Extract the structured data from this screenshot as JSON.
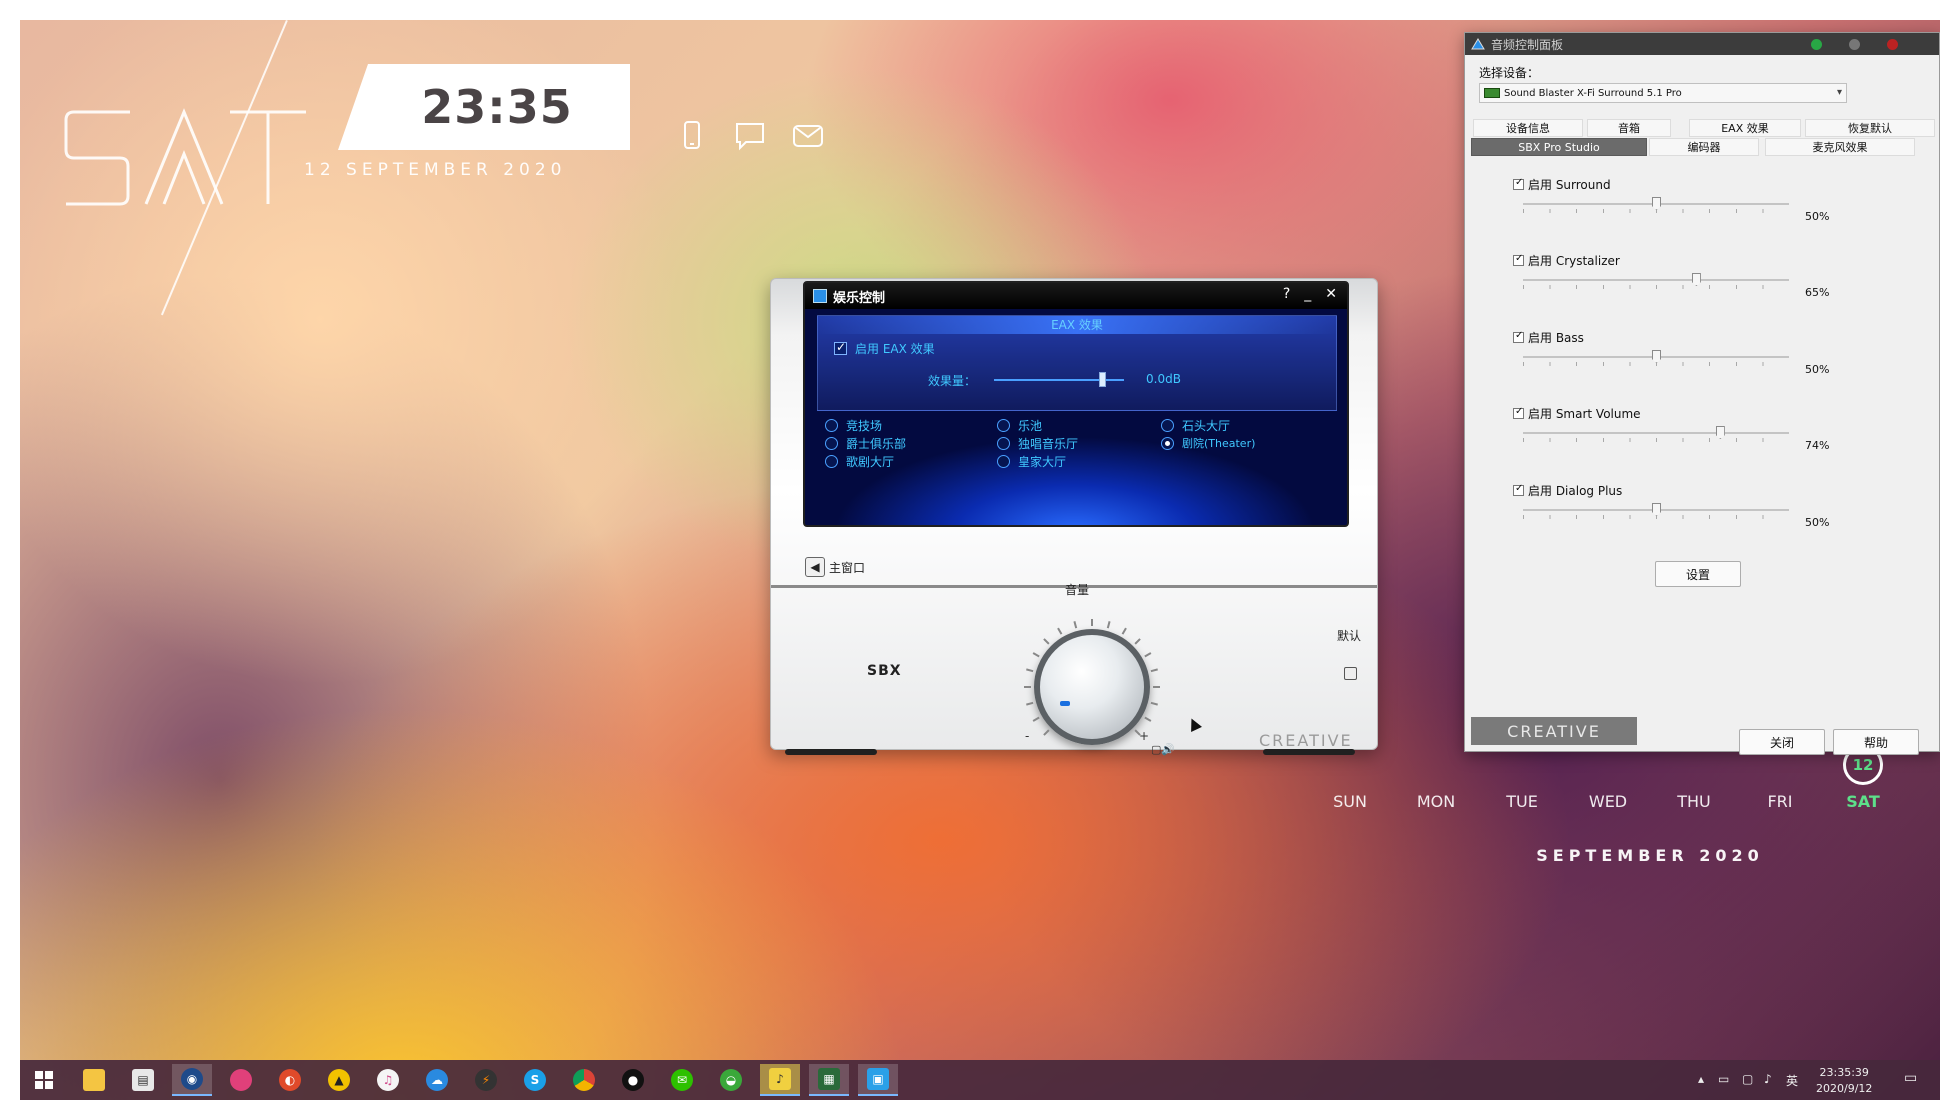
{
  "desktop": {
    "day": "SAT",
    "clock": "23:35",
    "date": "12 SEPTEMBER 2020",
    "widget_icons": [
      "phone-icon",
      "chat-icon",
      "mail-icon"
    ],
    "calendar": {
      "days": [
        "SUN",
        "MON",
        "TUE",
        "WED",
        "THU",
        "FRI",
        "SAT"
      ],
      "active_day": "SAT",
      "today_number": "12",
      "month": "SEPTEMBER 2020"
    }
  },
  "entertainment": {
    "title": "娱乐控制",
    "controls": [
      "?",
      "_",
      "✕"
    ],
    "eax_header": "EAX 效果",
    "enable_label": "启用 EAX 效果",
    "enable_checked": true,
    "amount_label": "效果量：",
    "amount_value": "0.0dB",
    "amount_fraction": 0.83,
    "presets": [
      {
        "label": "竞技场",
        "selected": false
      },
      {
        "label": "乐池",
        "selected": false
      },
      {
        "label": "石头大厅",
        "selected": false
      },
      {
        "label": "爵士俱乐部",
        "selected": false
      },
      {
        "label": "独唱音乐厅",
        "selected": false
      },
      {
        "label": "剧院(Theater)",
        "selected": true
      },
      {
        "label": "歌剧大厅",
        "selected": false
      },
      {
        "label": "皇家大厅",
        "selected": false
      }
    ],
    "main_window_label": "主窗口",
    "volume_label": "音量",
    "sbx_label": "SBX",
    "default_label": "默认",
    "minus": "-",
    "plus": "+",
    "logo": "CREATIVE"
  },
  "audio_panel": {
    "title": "音频控制面板",
    "select_label": "选择设备：",
    "device": "Sound Blaster X-Fi Surround 5.1 Pro",
    "tabs_row1": [
      "设备信息",
      "音箱",
      "EAX 效果",
      "恢复默认"
    ],
    "tabs_row2": [
      "SBX Pro Studio",
      "编码器",
      "麦克风效果"
    ],
    "active_tab": "SBX Pro Studio",
    "effects": [
      {
        "label": "启用 Surround",
        "checked": true,
        "value": "50%",
        "fraction": 0.5
      },
      {
        "label": "启用 Crystalizer",
        "checked": true,
        "value": "65%",
        "fraction": 0.65
      },
      {
        "label": "启用 Bass",
        "checked": true,
        "value": "50%",
        "fraction": 0.5
      },
      {
        "label": "启用 Smart Volume",
        "checked": true,
        "value": "74%",
        "fraction": 0.74
      },
      {
        "label": "启用 Dialog Plus",
        "checked": true,
        "value": "50%",
        "fraction": 0.5
      }
    ],
    "settings_button": "设置",
    "logo": "CREATIVE",
    "close_button": "关闭",
    "help_button": "帮助"
  },
  "taskbar": {
    "apps": [
      "start",
      "file-explorer",
      "store",
      "app-blue",
      "app-pink",
      "app-red",
      "app-yellow",
      "itunes",
      "cloud",
      "app-dark",
      "skype",
      "chrome",
      "qq",
      "wechat",
      "app-green",
      "app-yellow-2",
      "app-green-2",
      "app-sky"
    ],
    "ime": "英",
    "time": "23:35:39",
    "date": "2020/9/12"
  },
  "colors": {
    "accent_cyan": "#40c8ff",
    "calendar_active": "#5de08a",
    "panel_tab_active": "#6b6b6b"
  }
}
